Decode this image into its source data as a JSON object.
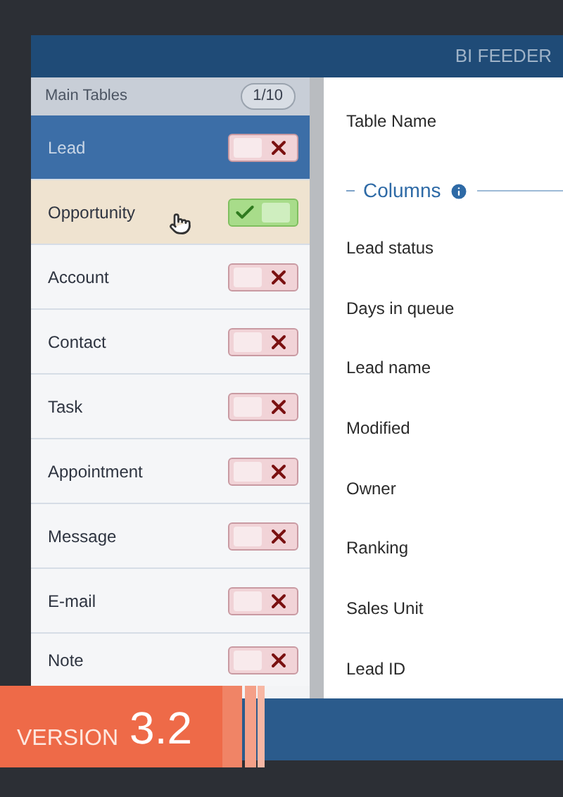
{
  "window": {
    "title": "BI FEEDER"
  },
  "sidebar": {
    "title": "Main Tables",
    "count": "1/10",
    "items": [
      {
        "label": "Lead",
        "selected": true,
        "hovered": false,
        "on": false
      },
      {
        "label": "Opportunity",
        "selected": false,
        "hovered": true,
        "on": true
      },
      {
        "label": "Account",
        "selected": false,
        "hovered": false,
        "on": false
      },
      {
        "label": "Contact",
        "selected": false,
        "hovered": false,
        "on": false
      },
      {
        "label": "Task",
        "selected": false,
        "hovered": false,
        "on": false
      },
      {
        "label": "Appointment",
        "selected": false,
        "hovered": false,
        "on": false
      },
      {
        "label": "Message",
        "selected": false,
        "hovered": false,
        "on": false
      },
      {
        "label": "E-mail",
        "selected": false,
        "hovered": false,
        "on": false
      },
      {
        "label": "Note",
        "selected": false,
        "hovered": false,
        "on": false
      }
    ]
  },
  "detail": {
    "table_name_label": "Table Name",
    "columns_title": "Columns",
    "columns": [
      "Lead status",
      "Days in queue",
      "Lead name",
      "Modified",
      "Owner",
      "Ranking",
      "Sales Unit",
      "Lead ID"
    ]
  },
  "banner": {
    "label": "VERSION",
    "version": "3.2"
  }
}
